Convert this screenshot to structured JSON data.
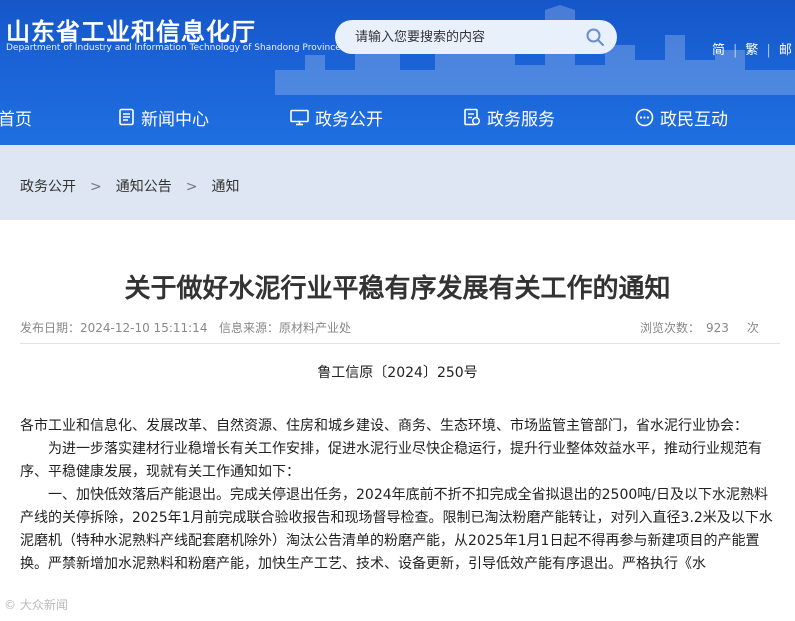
{
  "header": {
    "site_title": "山东省工业和信息化厅",
    "site_title_en": "Department of Industry and Information Technology of Shandong Province",
    "search_placeholder": "请输入您要搜索的内容",
    "links": [
      "简",
      "繁",
      "邮"
    ]
  },
  "nav": [
    {
      "label": "首页",
      "icon": "home-icon"
    },
    {
      "label": "新闻中心",
      "icon": "news-icon"
    },
    {
      "label": "政务公开",
      "icon": "monitor-icon"
    },
    {
      "label": "政务服务",
      "icon": "service-icon"
    },
    {
      "label": "政民互动",
      "icon": "interaction-icon"
    }
  ],
  "breadcrumb": [
    "政务公开",
    "通知公告",
    "通知"
  ],
  "breadcrumb_sep": ">",
  "article": {
    "title": "关于做好水泥行业平稳有序发展有关工作的通知",
    "publish_date": "发布日期：2024-12-10 15:11:14",
    "source": "信息来源：原材料产业处",
    "views_label": "浏览次数：",
    "views_count": "923",
    "views_unit": "次",
    "doc_number": "鲁工信原〔2024〕250号",
    "paragraphs": [
      "各市工业和信息化、发展改革、自然资源、住房和城乡建设、商务、生态环境、市场监管主管部门，省水泥行业协会：",
      "为进一步落实建材行业稳增长有关工作安排，促进水泥行业尽快企稳运行，提升行业整体效益水平，推动行业规范有序、平稳健康发展，现就有关工作通知如下：",
      "一、加快低效落后产能退出。完成关停退出任务，2024年底前不折不扣完成全省拟退出的2500吨/日及以下水泥熟料产线的关停拆除，2025年1月前完成联合验收报告和现场督导检查。限制已淘汰粉磨产能转让，对列入直径3.2米及以下水泥磨机（特种水泥熟料产线配套磨机除外）淘汰公告清单的粉磨产能，从2025年1月1日起不得再参与新建项目的产能置换。严禁新增加水泥熟料和粉磨产能，加快生产工艺、技术、设备更新，引导低效产能有序退出。严格执行《水"
    ]
  },
  "watermark": "© 大众新闻"
}
